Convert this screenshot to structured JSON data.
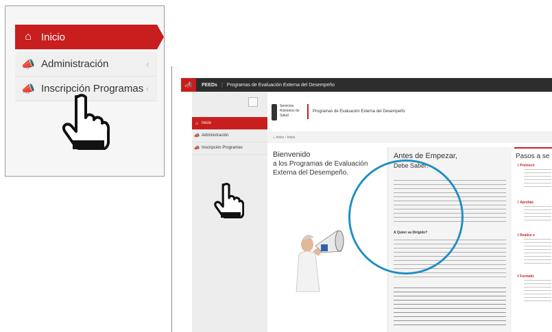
{
  "inset": {
    "menu": [
      {
        "label": "Inicio",
        "icon": "home-icon",
        "active": true
      },
      {
        "label": "Administración",
        "icon": "megaphone-icon",
        "active": false
      },
      {
        "label": "Inscripción Programas",
        "icon": "megaphone-icon",
        "active": false
      }
    ]
  },
  "site": {
    "topbar": {
      "brand": "PEEDs",
      "title": "Programas de Evaluación Externa del Desempeño"
    },
    "sidebar": [
      {
        "label": "Inicio",
        "active": true
      },
      {
        "label": "Administración",
        "active": false
      },
      {
        "label": "Inscripción Programas",
        "active": false
      }
    ],
    "header": {
      "org_line1": "Servicios",
      "org_line2": "Ricklorios de",
      "org_line3": "Salud",
      "title": "Programas de Evaluación Externa del Desempeño"
    },
    "breadcrumb": {
      "home": "Inicio",
      "current": "Inicio"
    },
    "welcome": {
      "line1": "Bienvenido",
      "line2": "a los Programas de Evaluación",
      "line3": "Externa del Desempeño."
    },
    "antes": {
      "title": "Antes de Empezar,",
      "subtitle": "Debe Saber:",
      "q1": "A Quien va Dirigido?"
    },
    "pasos": {
      "title": "Pasos a se",
      "steps": [
        {
          "n": "1",
          "label": "Preinscri"
        },
        {
          "n": "2",
          "label": "Aprobac"
        },
        {
          "n": "3",
          "label": "Realice e"
        },
        {
          "n": "4",
          "label": "Formalic"
        }
      ]
    }
  },
  "colors": {
    "accent": "#c81e1e",
    "highlight_circle": "#1f8fc4",
    "topbar": "#2d2d2d"
  }
}
